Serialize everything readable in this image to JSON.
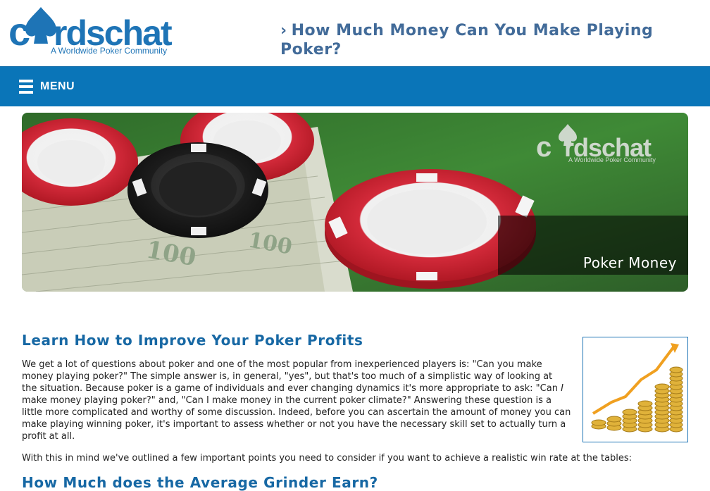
{
  "header": {
    "logo_text": "cardschat",
    "logo_tagline": "A Worldwide Poker Community",
    "chevron_icon": "chevron-right-icon",
    "page_title": "How Much Money Can You Make Playing Poker?"
  },
  "nav": {
    "menu_icon": "hamburger-icon",
    "menu_label": "MENU"
  },
  "hero": {
    "watermark_logo": "cardschat",
    "watermark_tagline": "A Worldwide Poker Community",
    "caption": "Poker Money"
  },
  "article": {
    "heading1": "Learn How to Improve Your Poker Profits",
    "paragraph1": [
      "We get a lot of questions about poker and one of the most popular from inexperienced players is: \"Can you make",
      "money playing poker?\" The simple answer is, in general, \"yes\", but that's too much of a simplistic way of looking at",
      "the situation. Because poker is a game of individuals and ever changing dynamics it's more appropriate to ask: \"Can",
      "make money playing poker?\" and, \"Can I make money in the current poker climate?\" Answering these question is a",
      "little more complicated and worthy of some discussion. Indeed, before you can ascertain the amount of money you can",
      "make playing winning poker, it's important to assess whether or not you have the necessary skill set to actually turn a",
      "profit at all."
    ],
    "paragraph1_emphasis": "I",
    "paragraph2": "With this in mind we've outlined a few important points you need to consider if you want to achieve a realistic win rate at the tables:",
    "heading2": "How Much does the Average Grinder Earn?",
    "side_image": "coin-stacks-growth-chart-image"
  },
  "colors": {
    "nav_bg": "#0a75b8",
    "title_blue": "#426b99",
    "heading_blue": "#1768a4",
    "logo_blue": "#1e74b6"
  }
}
